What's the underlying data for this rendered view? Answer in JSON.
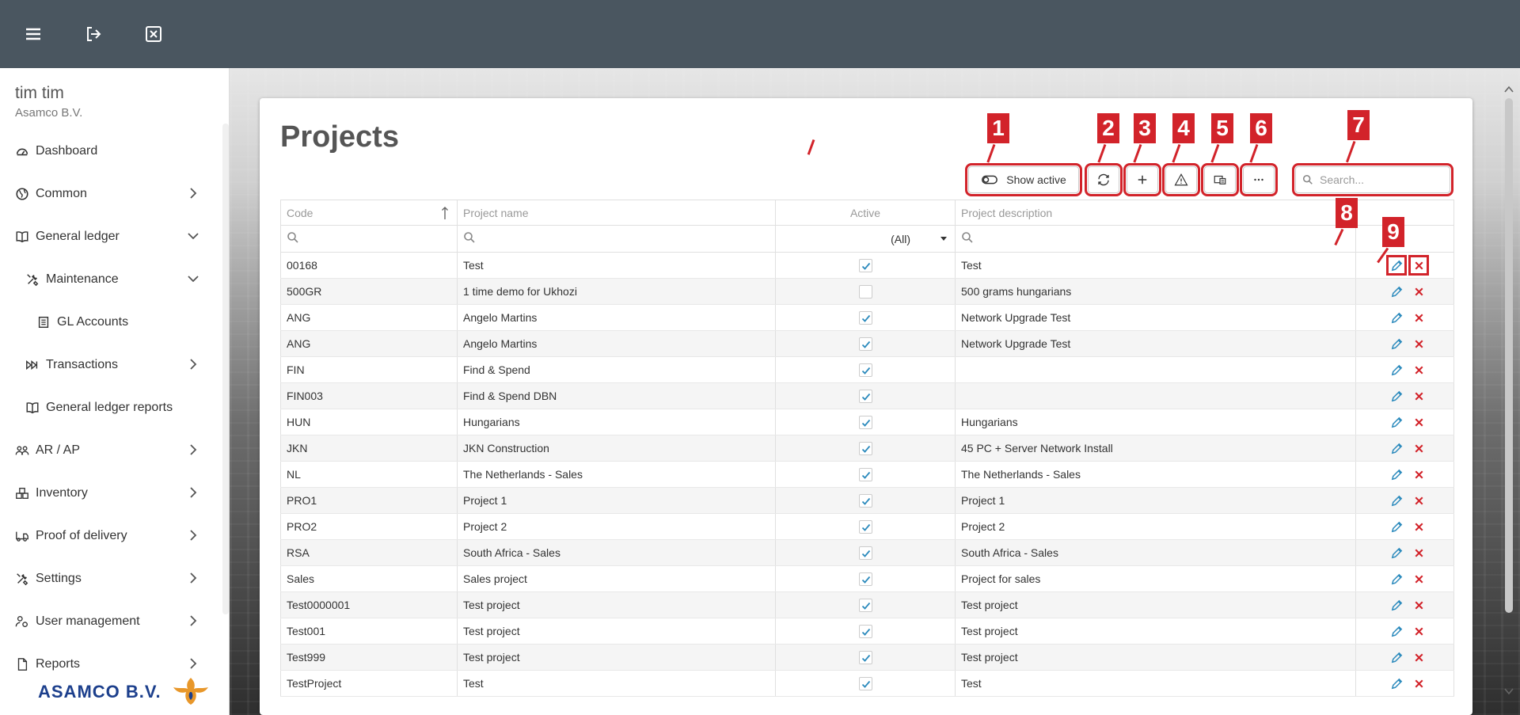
{
  "user": {
    "name": "tim tim",
    "company": "Asamco B.V."
  },
  "logo_text": "ASAMCO B.V.",
  "nav": [
    {
      "label": "Dashboard",
      "icon": "dashboard-icon"
    },
    {
      "label": "Common",
      "icon": "globe-icon"
    },
    {
      "label": "General ledger",
      "icon": "book-icon"
    },
    {
      "label": "Maintenance",
      "icon": "tools-icon"
    },
    {
      "label": "GL Accounts",
      "icon": "list-icon"
    },
    {
      "label": "Transactions",
      "icon": "transactions-icon"
    },
    {
      "label": "General ledger reports",
      "icon": "book-icon"
    },
    {
      "label": "AR / AP",
      "icon": "users-icon"
    },
    {
      "label": "Inventory",
      "icon": "boxes-icon"
    },
    {
      "label": "Proof of delivery",
      "icon": "truck-icon"
    },
    {
      "label": "Settings",
      "icon": "tools-icon"
    },
    {
      "label": "User management",
      "icon": "user-gear-icon"
    },
    {
      "label": "Reports",
      "icon": "file-icon"
    }
  ],
  "page": {
    "title": "Projects"
  },
  "toolbar": {
    "show_active_label": "Show active",
    "search_placeholder": "Search..."
  },
  "annotations": [
    "1",
    "2",
    "3",
    "4",
    "5",
    "6",
    "7",
    "8",
    "9"
  ],
  "colors": {
    "highlight": "#d2232a",
    "edit": "#2d8bbd",
    "delete": "#d2232a",
    "topbar": "#4a5660"
  },
  "grid": {
    "columns": [
      "Code",
      "Project name",
      "Active",
      "Project description"
    ],
    "filter_select": "(All)",
    "rows": [
      {
        "code": "00168",
        "name": "Test",
        "active": true,
        "description": "Test"
      },
      {
        "code": "500GR",
        "name": "1 time demo for Ukhozi",
        "active": false,
        "description": "500 grams hungarians"
      },
      {
        "code": "ANG",
        "name": "Angelo Martins",
        "active": true,
        "description": "Network Upgrade Test"
      },
      {
        "code": "ANG",
        "name": "Angelo Martins",
        "active": true,
        "description": "Network Upgrade Test"
      },
      {
        "code": "FIN",
        "name": "Find & Spend",
        "active": true,
        "description": ""
      },
      {
        "code": "FIN003",
        "name": "Find & Spend DBN",
        "active": true,
        "description": ""
      },
      {
        "code": "HUN",
        "name": "Hungarians",
        "active": true,
        "description": "Hungarians"
      },
      {
        "code": "JKN",
        "name": "JKN Construction",
        "active": true,
        "description": "45 PC + Server Network Install"
      },
      {
        "code": "NL",
        "name": "The Netherlands - Sales",
        "active": true,
        "description": "The Netherlands - Sales"
      },
      {
        "code": "PRO1",
        "name": "Project 1",
        "active": true,
        "description": "Project 1"
      },
      {
        "code": "PRO2",
        "name": "Project 2",
        "active": true,
        "description": "Project 2"
      },
      {
        "code": "RSA",
        "name": "South Africa - Sales",
        "active": true,
        "description": "South Africa - Sales"
      },
      {
        "code": "Sales",
        "name": "Sales project",
        "active": true,
        "description": "Project for sales"
      },
      {
        "code": "Test0000001",
        "name": "Test project",
        "active": true,
        "description": "Test project"
      },
      {
        "code": "Test001",
        "name": "Test project",
        "active": true,
        "description": "Test project"
      },
      {
        "code": "Test999",
        "name": "Test project",
        "active": true,
        "description": "Test project"
      },
      {
        "code": "TestProject",
        "name": "Test",
        "active": true,
        "description": "Test"
      }
    ]
  }
}
